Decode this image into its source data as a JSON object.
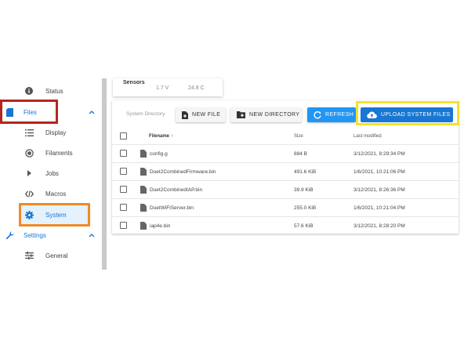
{
  "sidebar": {
    "items": [
      {
        "label": "Status",
        "icon": "info-icon",
        "level": "sub"
      },
      {
        "label": "Files",
        "icon": "sd-card-icon",
        "level": "top",
        "expanded": true
      },
      {
        "label": "Display",
        "icon": "list-icon",
        "level": "sub"
      },
      {
        "label": "Filaments",
        "icon": "radio-icon",
        "level": "sub"
      },
      {
        "label": "Jobs",
        "icon": "play-icon",
        "level": "sub"
      },
      {
        "label": "Macros",
        "icon": "code-icon",
        "level": "sub"
      },
      {
        "label": "System",
        "icon": "gear-icon",
        "level": "sub",
        "active": true
      },
      {
        "label": "Settings",
        "icon": "wrench-icon",
        "level": "top",
        "expanded": true
      },
      {
        "label": "General",
        "icon": "tune-icon",
        "level": "sub"
      }
    ]
  },
  "sensors": {
    "title": "Sensors",
    "values": [
      "1.7 V",
      "24.8 C"
    ]
  },
  "toolbar": {
    "directory_label": "System Directory",
    "new_file": "NEW FILE",
    "new_directory": "NEW DIRECTORY",
    "refresh": "REFRESH",
    "upload": "UPLOAD SYSTEM FILES"
  },
  "table": {
    "headers": {
      "filename": "Filename",
      "size": "Size",
      "modified": "Last modified"
    },
    "sort_indicator": "↑",
    "rows": [
      {
        "name": "config.g",
        "size": "884 B",
        "modified": "3/12/2021, 8:29:34 PM"
      },
      {
        "name": "Duet2CombinedFirmware.bin",
        "size": "491.6 KiB",
        "modified": "1/6/2021, 10:21:06 PM"
      },
      {
        "name": "Duet2CombinedIAP.bin",
        "size": "39.9 KiB",
        "modified": "3/12/2021, 8:26:36 PM"
      },
      {
        "name": "DuetWiFiServer.bin",
        "size": "255.0 KiB",
        "modified": "1/6/2021, 10:21:04 PM"
      },
      {
        "name": "iap4e.bin",
        "size": "57.6 KiB",
        "modified": "3/12/2021, 8:28:20 PM"
      }
    ]
  },
  "colors": {
    "accent": "#1976d2",
    "button_blue": "#2196f3",
    "highlight_red": "#b3261e",
    "highlight_orange": "#f08a24",
    "highlight_yellow": "#f2e22a"
  }
}
